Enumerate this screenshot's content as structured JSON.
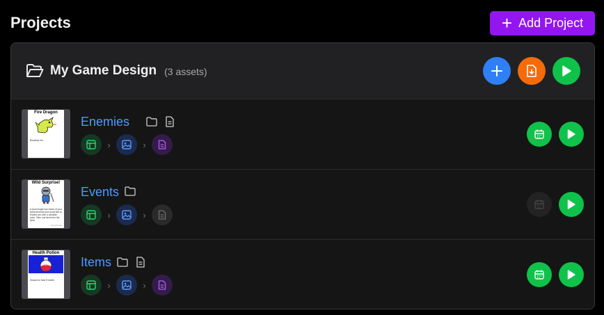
{
  "page": {
    "title": "Projects",
    "add_button_label": "Add Project"
  },
  "project": {
    "name": "My Game Design",
    "asset_count_label": "(3 assets)"
  },
  "colors": {
    "accent_purple": "#9316f0",
    "blue": "#2f7ff5",
    "orange": "#f56b0a",
    "green": "#0fc24a",
    "link_blue": "#4d9bff"
  },
  "rows": [
    {
      "name": "Enemies",
      "has_doc_icon": true,
      "doc_step_active": true,
      "schedule_enabled": true,
      "card": {
        "title": "Fire Dragon",
        "text": "Breathes fire.",
        "footer": ""
      }
    },
    {
      "name": "Events",
      "has_doc_icon": false,
      "doc_step_active": false,
      "schedule_enabled": false,
      "card": {
        "title": "Wild Surprise!",
        "text": "A local knight has heard of your achievements and would like to reward you with a valuable prize. Gain one item from the deck.",
        "footer": "Fine print text"
      }
    },
    {
      "name": "Items",
      "has_doc_icon": true,
      "doc_step_active": true,
      "schedule_enabled": true,
      "card": {
        "title": "Health Potion",
        "text": "Discard to heal 5 health.",
        "footer": ""
      }
    }
  ]
}
